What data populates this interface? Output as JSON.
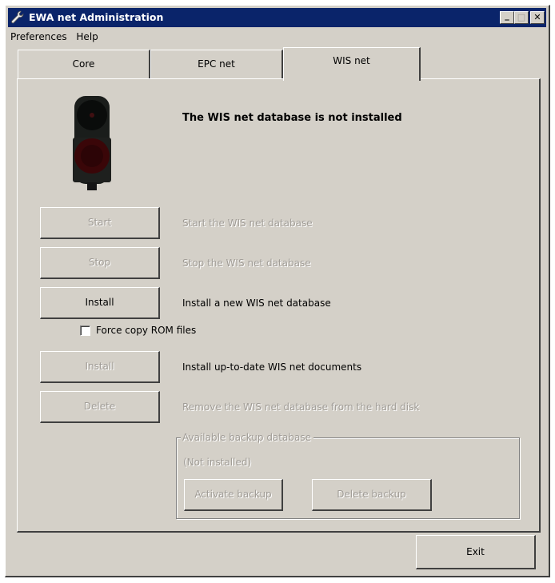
{
  "window": {
    "title": "EWA net Administration",
    "controls": {
      "minimize": "_",
      "maximize": "□",
      "close": "✕"
    }
  },
  "menu": [
    "Preferences",
    "Help"
  ],
  "tabs": [
    {
      "label": "Core",
      "active": false
    },
    {
      "label": "EPC net",
      "active": false
    },
    {
      "label": "WIS net",
      "active": true
    }
  ],
  "status": {
    "message": "The WIS net database is not installed",
    "light": "red",
    "light_colors": {
      "housing": "#1a1d1b",
      "top_lamp": "#0a0c0b",
      "bottom_lamp": "#3a0608"
    }
  },
  "actions": [
    {
      "button": "Start",
      "enabled": false,
      "description": "Start the WIS net database",
      "description_enabled": false
    },
    {
      "button": "Stop",
      "enabled": false,
      "description": "Stop the WIS net database",
      "description_enabled": false
    },
    {
      "button": "Install",
      "enabled": true,
      "description": "Install a new WIS net database",
      "description_enabled": true
    },
    {
      "button": "Install",
      "enabled": false,
      "description": "Install up-to-date WIS net documents",
      "description_enabled": true
    },
    {
      "button": "Delete",
      "enabled": false,
      "description": "Remove the WIS net database from the hard disk",
      "description_enabled": false
    }
  ],
  "force_copy": {
    "label": "Force copy ROM files",
    "checked": false
  },
  "backup": {
    "legend": "Available backup database",
    "state": "(Not installed)",
    "activate_label": "Activate backup",
    "delete_label": "Delete backup"
  },
  "footer": {
    "exit_label": "Exit"
  }
}
